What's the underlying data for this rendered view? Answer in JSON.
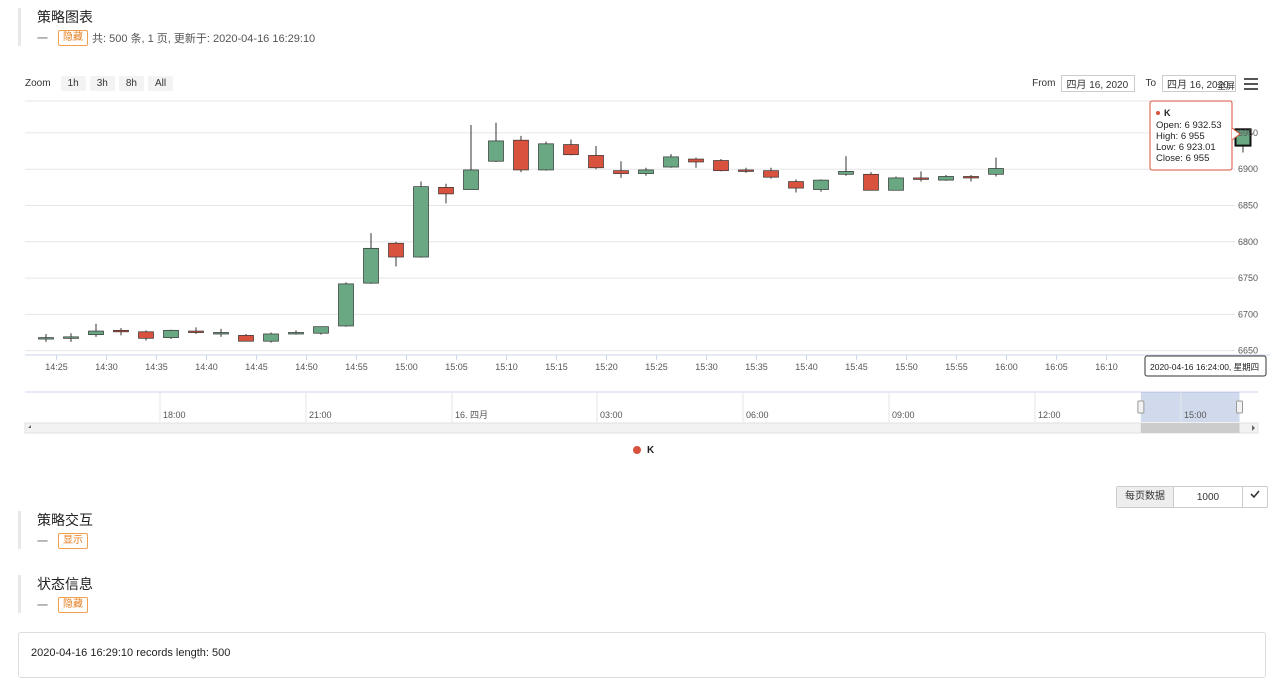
{
  "strategy_chart": {
    "title": "策略图表",
    "dash": "一",
    "toggle": "隐藏",
    "meta": "共: 500 条, 1 页, 更新于: 2020-04-16 16:29:10"
  },
  "controls": {
    "zoom_label": "Zoom",
    "zoom_buttons": [
      "1h",
      "3h",
      "8h",
      "All"
    ],
    "from_label": "From",
    "from_value": "四月 16, 2020",
    "to_label": "To",
    "to_value": "四月 16, 2020",
    "fullscreen": "全屏"
  },
  "chart_data": {
    "type": "candlestick",
    "series_name": "K",
    "x_ticks": [
      "14:25",
      "14:30",
      "14:35",
      "14:40",
      "14:45",
      "14:50",
      "14:55",
      "15:00",
      "15:05",
      "15:10",
      "15:15",
      "15:20",
      "15:25",
      "15:30",
      "15:35",
      "15:40",
      "15:45",
      "15:50",
      "15:55",
      "16:00",
      "16:05",
      "16:10"
    ],
    "y_ticks": [
      6650,
      6700,
      6750,
      6800,
      6850,
      6900,
      6950
    ],
    "ylim": [
      6644,
      6994
    ],
    "grid": true,
    "candles": [
      {
        "o": 6668,
        "h": 6673,
        "l": 6662,
        "c": 6668
      },
      {
        "o": 6668,
        "h": 6674,
        "l": 6662,
        "c": 6669
      },
      {
        "o": 6672,
        "h": 6687,
        "l": 6669,
        "c": 6677
      },
      {
        "o": 6678,
        "h": 6681,
        "l": 6671,
        "c": 6676
      },
      {
        "o": 6676,
        "h": 6678,
        "l": 6664,
        "c": 6667
      },
      {
        "o": 6668,
        "h": 6679,
        "l": 6666,
        "c": 6678
      },
      {
        "o": 6677,
        "h": 6682,
        "l": 6673,
        "c": 6676
      },
      {
        "o": 6675,
        "h": 6680,
        "l": 6669,
        "c": 6675
      },
      {
        "o": 6671,
        "h": 6673,
        "l": 6663,
        "c": 6663
      },
      {
        "o": 6663,
        "h": 6675,
        "l": 6661,
        "c": 6673
      },
      {
        "o": 6674,
        "h": 6678,
        "l": 6672,
        "c": 6675
      },
      {
        "o": 6674,
        "h": 6682,
        "l": 6672,
        "c": 6683
      },
      {
        "o": 6684,
        "h": 6744,
        "l": 6683,
        "c": 6742
      },
      {
        "o": 6743,
        "h": 6812,
        "l": 6742,
        "c": 6791
      },
      {
        "o": 6798,
        "h": 6800,
        "l": 6766,
        "c": 6779
      },
      {
        "o": 6779,
        "h": 6883,
        "l": 6778,
        "c": 6876
      },
      {
        "o": 6875,
        "h": 6880,
        "l": 6853,
        "c": 6866
      },
      {
        "o": 6872,
        "h": 6961,
        "l": 6872,
        "c": 6899
      },
      {
        "o": 6911,
        "h": 6964,
        "l": 6910,
        "c": 6939
      },
      {
        "o": 6940,
        "h": 6946,
        "l": 6896,
        "c": 6899
      },
      {
        "o": 6899,
        "h": 6938,
        "l": 6898,
        "c": 6935
      },
      {
        "o": 6934,
        "h": 6941,
        "l": 6919,
        "c": 6920
      },
      {
        "o": 6919,
        "h": 6932,
        "l": 6900,
        "c": 6902
      },
      {
        "o": 6898,
        "h": 6911,
        "l": 6888,
        "c": 6894
      },
      {
        "o": 6894,
        "h": 6902,
        "l": 6891,
        "c": 6899
      },
      {
        "o": 6903,
        "h": 6921,
        "l": 6902,
        "c": 6917
      },
      {
        "o": 6914,
        "h": 6916,
        "l": 6902,
        "c": 6910
      },
      {
        "o": 6912,
        "h": 6914,
        "l": 6897,
        "c": 6898
      },
      {
        "o": 6899,
        "h": 6902,
        "l": 6895,
        "c": 6897
      },
      {
        "o": 6898,
        "h": 6902,
        "l": 6887,
        "c": 6889
      },
      {
        "o": 6883,
        "h": 6886,
        "l": 6868,
        "c": 6874
      },
      {
        "o": 6872,
        "h": 6886,
        "l": 6869,
        "c": 6885
      },
      {
        "o": 6893,
        "h": 6918,
        "l": 6891,
        "c": 6897
      },
      {
        "o": 6893,
        "h": 6896,
        "l": 6871,
        "c": 6871
      },
      {
        "o": 6871,
        "h": 6890,
        "l": 6871,
        "c": 6888
      },
      {
        "o": 6888,
        "h": 6897,
        "l": 6883,
        "c": 6886
      },
      {
        "o": 6885,
        "h": 6892,
        "l": 6884,
        "c": 6890
      },
      {
        "o": 6890,
        "h": 6892,
        "l": 6883,
        "c": 6889
      },
      {
        "o": 6893,
        "h": 6916,
        "l": 6890,
        "c": 6901
      },
      {
        "o": 6932.53,
        "h": 6955,
        "l": 6923.01,
        "c": 6955
      }
    ],
    "tooltip": {
      "series": "K",
      "open_label": "Open:",
      "open": "6 932.53",
      "high_label": "High:",
      "high": "6 955",
      "low_label": "Low:",
      "low": "6 923.01",
      "close_label": "Close:",
      "close": "6 955"
    },
    "hover_time": "2020-04-16 16:24:00, 星期四",
    "navigator_ticks": [
      "18:00",
      "21:00",
      "16. 四月",
      "03:00",
      "06:00",
      "09:00",
      "12:00",
      "15:00"
    ],
    "navigator_window": [
      0.905,
      0.985
    ],
    "legend": "K",
    "colors": {
      "up": "#6aa783",
      "down": "#d9523e",
      "wick": "#333333"
    }
  },
  "interaction": {
    "title": "策略交互",
    "dash": "一",
    "toggle": "显示"
  },
  "status": {
    "title": "状态信息",
    "dash": "一",
    "toggle": "隐藏"
  },
  "pager": {
    "label": "每页数据",
    "value": "1000",
    "confirm_icon": "check-icon"
  },
  "log": {
    "text": "2020-04-16 16:29:10 records length: 500"
  }
}
